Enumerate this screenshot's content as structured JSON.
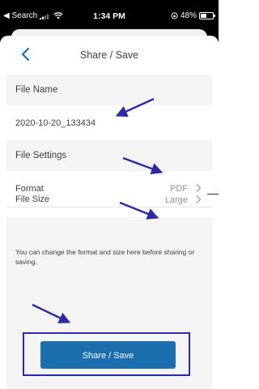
{
  "status_bar": {
    "carrier": "◀ Search",
    "time": "1:34 PM",
    "battery": "48%",
    "battery_level": 0.48
  },
  "header": {
    "title": "Share / Save",
    "back_icon": "chevron-left-icon"
  },
  "file_name_section": {
    "heading": "File Name",
    "value": "2020-10-20_133434"
  },
  "file_settings_section": {
    "heading": "File Settings",
    "rows": [
      {
        "label": "Format",
        "value": "PDF",
        "icon": "chevron-right-icon"
      },
      {
        "label": "File Size",
        "value": "Large",
        "icon": "chevron-right-icon"
      }
    ]
  },
  "info": {
    "text": "You can change the format and size here before sharing or saving."
  },
  "cta": {
    "label": "Share / Save"
  },
  "colors": {
    "accent": "#1b6fae",
    "annotation": "#2a2aa8",
    "section_bg": "#f4f4f4"
  }
}
